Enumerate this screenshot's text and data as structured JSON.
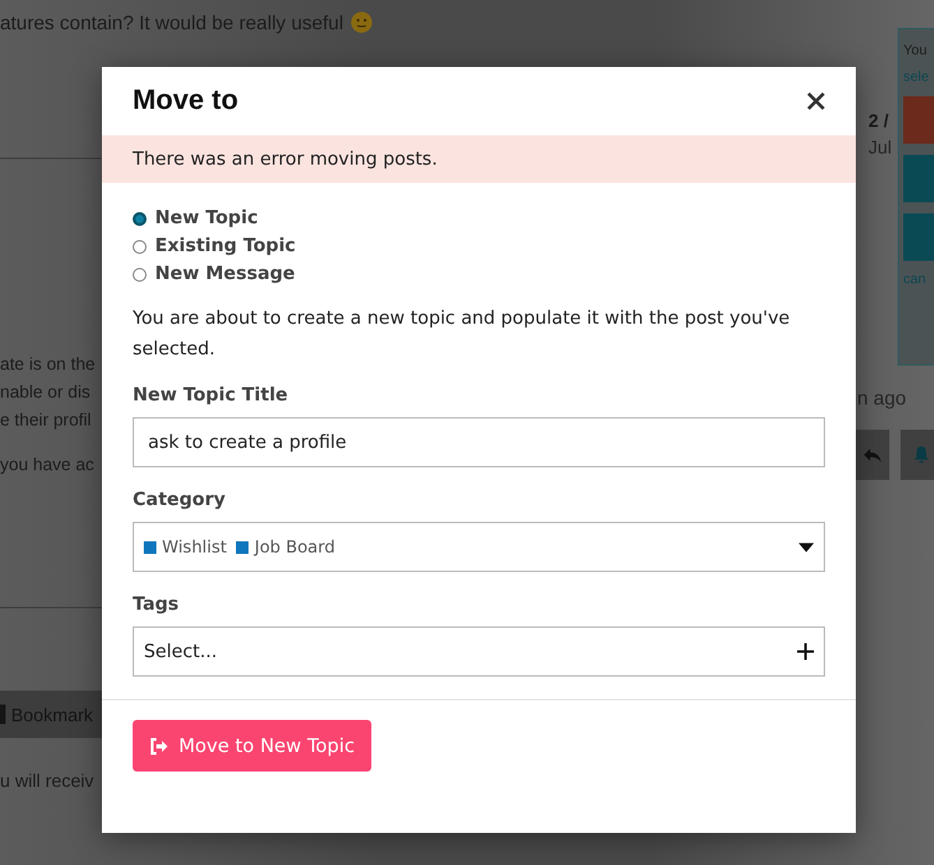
{
  "background": {
    "post_text": "atures contain? It would be really useful",
    "left_fragments": [
      "ate is on the",
      "nable or dis",
      "e their profil",
      "you have ac"
    ],
    "bookmark_button": "Bookmark",
    "notice": "u will receiv",
    "right_panel": {
      "text": "You",
      "link": "sele",
      "cancel": "can"
    },
    "progress": "2 /",
    "date": "Jul",
    "time_ago": "n ago"
  },
  "modal": {
    "title": "Move to",
    "error": "There was an error moving posts.",
    "options": [
      {
        "label": "New Topic",
        "selected": true
      },
      {
        "label": "Existing Topic",
        "selected": false
      },
      {
        "label": "New Message",
        "selected": false
      }
    ],
    "description": "You are about to create a new topic and populate it with the post you've selected.",
    "title_label": "New Topic Title",
    "title_value": "ask to create a profile",
    "category_label": "Category",
    "categories": [
      {
        "name": "Wishlist",
        "color": "#0e76bd"
      },
      {
        "name": "Job Board",
        "color": "#0e76bd"
      }
    ],
    "tags_label": "Tags",
    "tags_placeholder": "Select...",
    "submit": "Move to New Topic"
  }
}
